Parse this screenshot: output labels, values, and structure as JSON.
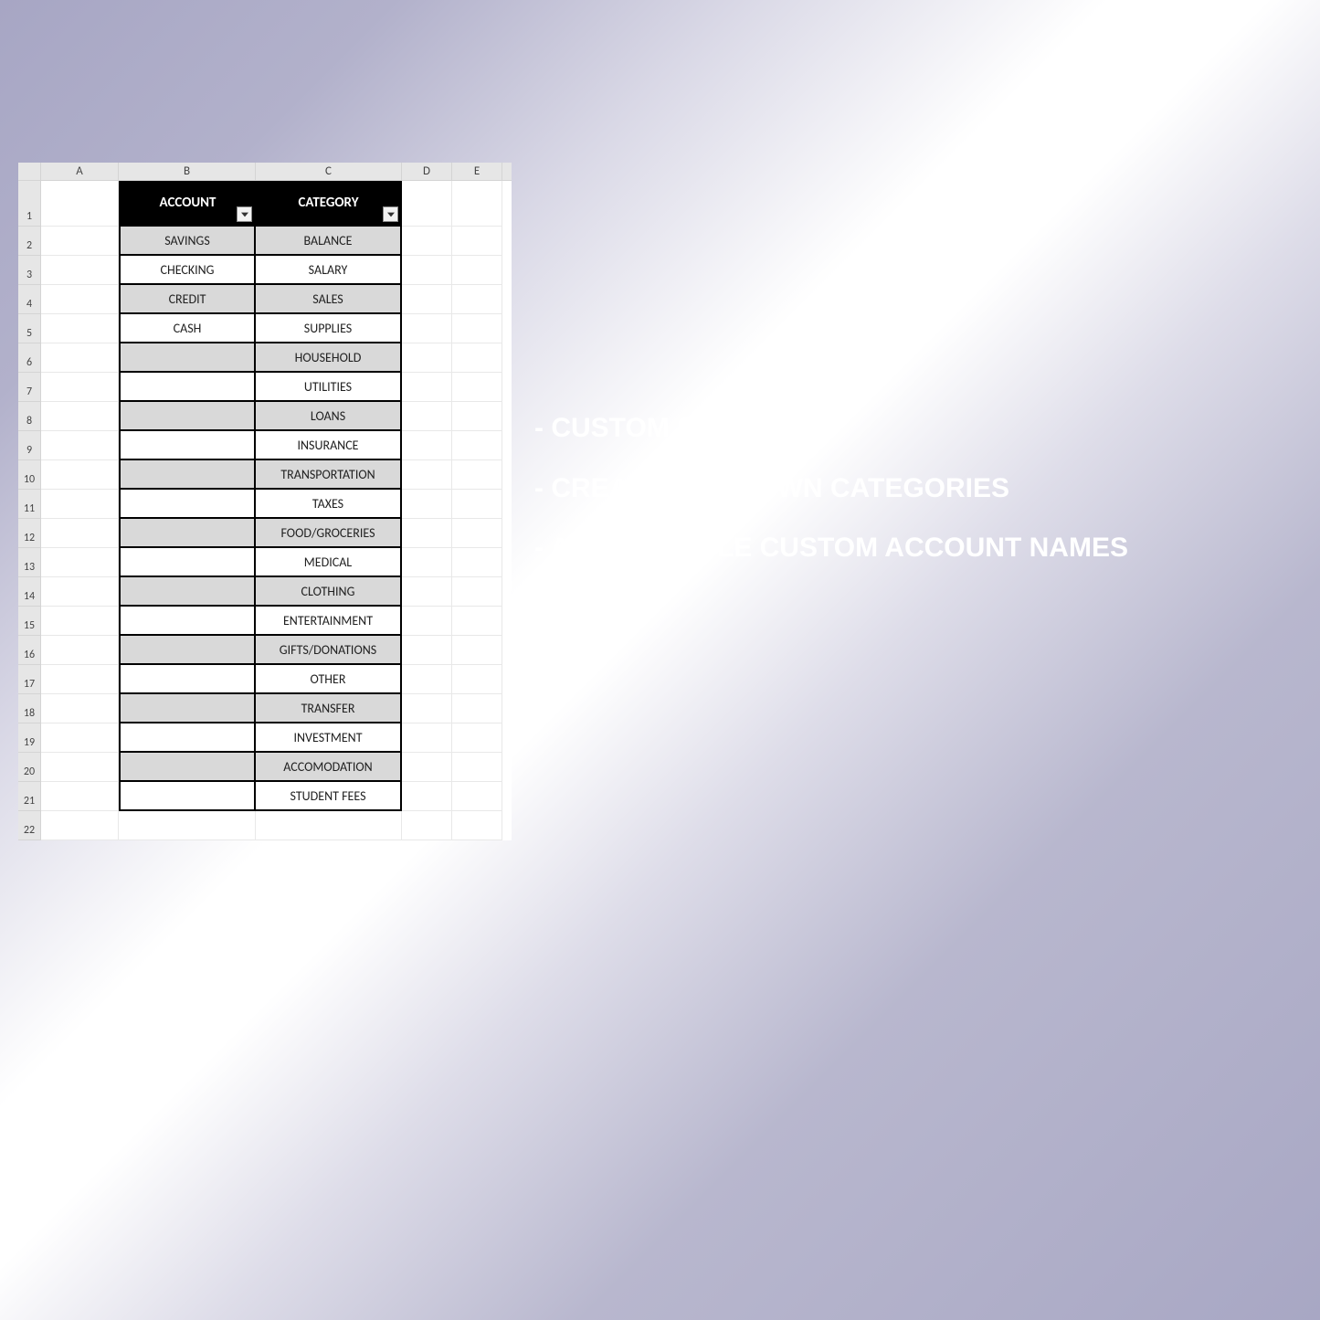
{
  "columns": [
    "A",
    "B",
    "C",
    "D",
    "E"
  ],
  "rowNumbers": [
    "1",
    "2",
    "3",
    "4",
    "5",
    "6",
    "7",
    "8",
    "9",
    "10",
    "11",
    "12",
    "13",
    "14",
    "15",
    "16",
    "17",
    "18",
    "19",
    "20",
    "21",
    "22"
  ],
  "headers": {
    "account": "ACCOUNT",
    "category": "CATEGORY"
  },
  "rows": [
    {
      "account": "SAVINGS",
      "category": "BALANCE",
      "shaded": true
    },
    {
      "account": "CHECKING",
      "category": "SALARY",
      "shaded": false
    },
    {
      "account": "CREDIT",
      "category": "SALES",
      "shaded": true
    },
    {
      "account": "CASH",
      "category": "SUPPLIES",
      "shaded": false
    },
    {
      "account": "",
      "category": "HOUSEHOLD",
      "shaded": true
    },
    {
      "account": "",
      "category": "UTILITIES",
      "shaded": false
    },
    {
      "account": "",
      "category": "LOANS",
      "shaded": true
    },
    {
      "account": "",
      "category": "INSURANCE",
      "shaded": false
    },
    {
      "account": "",
      "category": "TRANSPORTATION",
      "shaded": true
    },
    {
      "account": "",
      "category": "TAXES",
      "shaded": false
    },
    {
      "account": "",
      "category": "FOOD/GROCERIES",
      "shaded": true
    },
    {
      "account": "",
      "category": "MEDICAL",
      "shaded": false
    },
    {
      "account": "",
      "category": "CLOTHING",
      "shaded": true
    },
    {
      "account": "",
      "category": "ENTERTAINMENT",
      "shaded": false
    },
    {
      "account": "",
      "category": "GIFTS/DONATIONS",
      "shaded": true
    },
    {
      "account": "",
      "category": "OTHER",
      "shaded": false
    },
    {
      "account": "",
      "category": "TRANSFER",
      "shaded": true
    },
    {
      "account": "",
      "category": "INVESTMENT",
      "shaded": false
    },
    {
      "account": "",
      "category": "ACCOMODATION",
      "shaded": true
    },
    {
      "account": "",
      "category": "STUDENT FEES",
      "shaded": false
    }
  ],
  "marketing": {
    "line1": "- CUSTOM SETUP",
    "line2": "- CREATE YOUR OWN CATEGORIES",
    "line3": "- ADD MULTIPLE CUSTOM ACCOUNT NAMES"
  }
}
